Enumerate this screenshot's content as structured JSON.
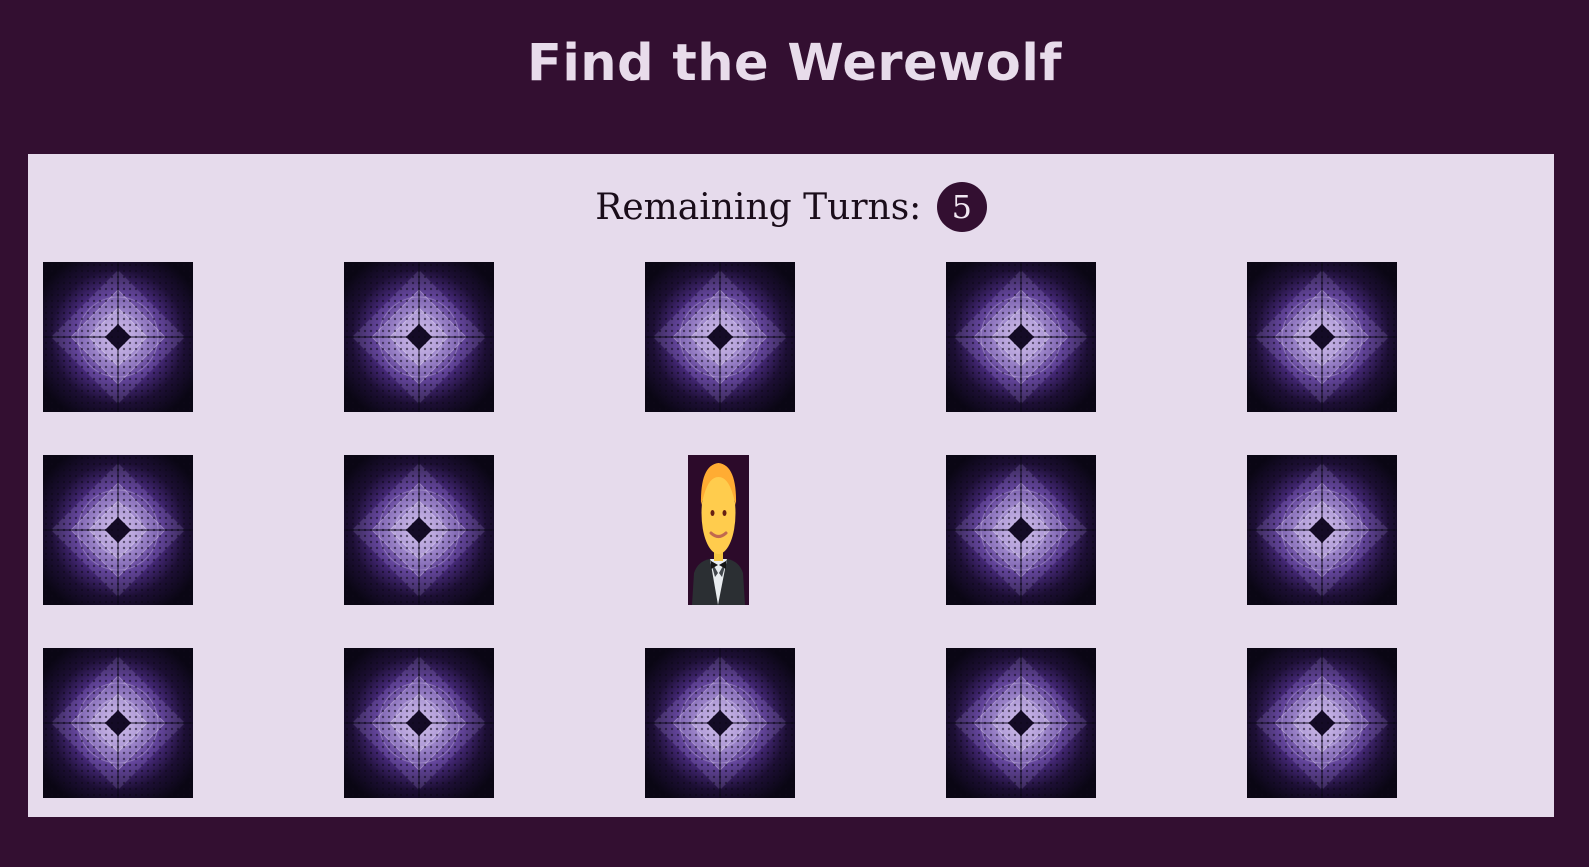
{
  "header": {
    "title": "Find the Werewolf"
  },
  "status": {
    "turns_label": "Remaining Turns:",
    "turns_value": "5"
  },
  "board": {
    "rows": 3,
    "cols": 5,
    "revealed_cell": {
      "row": 1,
      "col": 2,
      "character": "man-in-tuxedo"
    }
  },
  "colors": {
    "page_background": "#330f31",
    "board_background": "#e6dbec",
    "title_text": "#e8dceb",
    "badge_background": "#330f31"
  }
}
